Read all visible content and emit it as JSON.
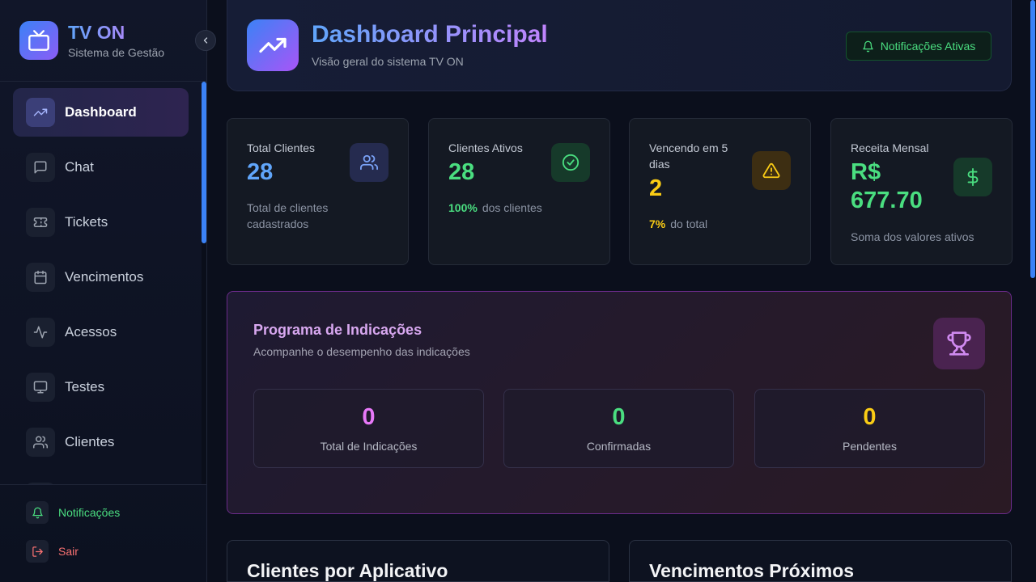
{
  "brand": {
    "title": "TV ON",
    "subtitle": "Sistema de Gestão"
  },
  "sidebar": {
    "items": [
      {
        "label": "Dashboard",
        "icon": "trending-up-icon",
        "active": true
      },
      {
        "label": "Chat",
        "icon": "message-square-icon"
      },
      {
        "label": "Tickets",
        "icon": "ticket-icon"
      },
      {
        "label": "Vencimentos",
        "icon": "calendar-icon"
      },
      {
        "label": "Acessos",
        "icon": "activity-icon"
      },
      {
        "label": "Testes",
        "icon": "monitor-icon"
      },
      {
        "label": "Clientes",
        "icon": "users-icon"
      }
    ],
    "footer": {
      "notifications_label": "Notificações",
      "logout_label": "Sair"
    }
  },
  "header": {
    "title": "Dashboard Principal",
    "subtitle": "Visão geral do sistema TV ON",
    "notifications_button": "Notificações Ativas"
  },
  "stats": [
    {
      "label": "Total Clientes",
      "value": "28",
      "desc": "Total de clientes cadastrados",
      "color": "#60a5fa"
    },
    {
      "label": "Clientes Ativos",
      "value": "28",
      "highlight": "100%",
      "desc": "dos clientes",
      "color": "#4ade80"
    },
    {
      "label": "Vencendo em 5 dias",
      "value": "2",
      "highlight": "7%",
      "desc": "do total",
      "color": "#facc15"
    },
    {
      "label": "Receita Mensal",
      "value": "R$ 677.70",
      "desc": "Soma dos valores ativos",
      "color": "#4ade80"
    }
  ],
  "referrals": {
    "title": "Programa de Indicações",
    "subtitle": "Acompanhe o desempenho das indicações",
    "boxes": [
      {
        "value": "0",
        "label": "Total de Indicações",
        "color": "#e879f9"
      },
      {
        "value": "0",
        "label": "Confirmadas",
        "color": "#4ade80"
      },
      {
        "value": "0",
        "label": "Pendentes",
        "color": "#facc15"
      }
    ]
  },
  "bottom": {
    "left_title": "Clientes por Aplicativo",
    "right_title": "Vencimentos Próximos"
  },
  "colors": {
    "accent_blue": "#3b82f6",
    "accent_purple": "#a855f7",
    "success": "#4ade80",
    "warning": "#facc15",
    "danger": "#f87171"
  }
}
